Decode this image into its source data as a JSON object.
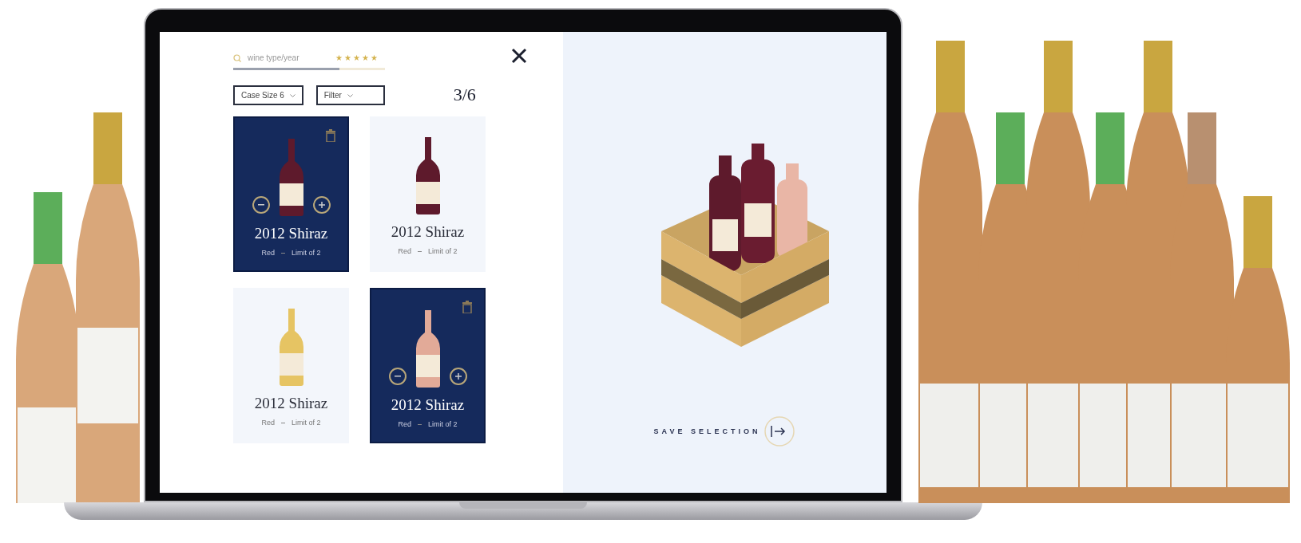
{
  "search": {
    "placeholder": "wine type/year",
    "stars": 5,
    "level": 0.7
  },
  "dropdowns": [
    {
      "label": "Case Size 6"
    },
    {
      "label": "Filter"
    }
  ],
  "counter": "3/6",
  "cards": [
    {
      "name": "2012 Shiraz",
      "type": "Red",
      "limit": "Limit of 2",
      "selected": true,
      "color": "#5e1a2c"
    },
    {
      "name": "2012 Shiraz",
      "type": "Red",
      "limit": "Limit of 2",
      "selected": false,
      "color": "#5e1a2c"
    },
    {
      "name": "2012 Shiraz",
      "type": "Red",
      "limit": "Limit of 2",
      "selected": false,
      "color": "#e6c463"
    },
    {
      "name": "2012 Shiraz",
      "type": "Red",
      "limit": "Limit of 2",
      "selected": true,
      "color": "#e2aa98"
    }
  ],
  "save_button": "SAVE SELECTION"
}
